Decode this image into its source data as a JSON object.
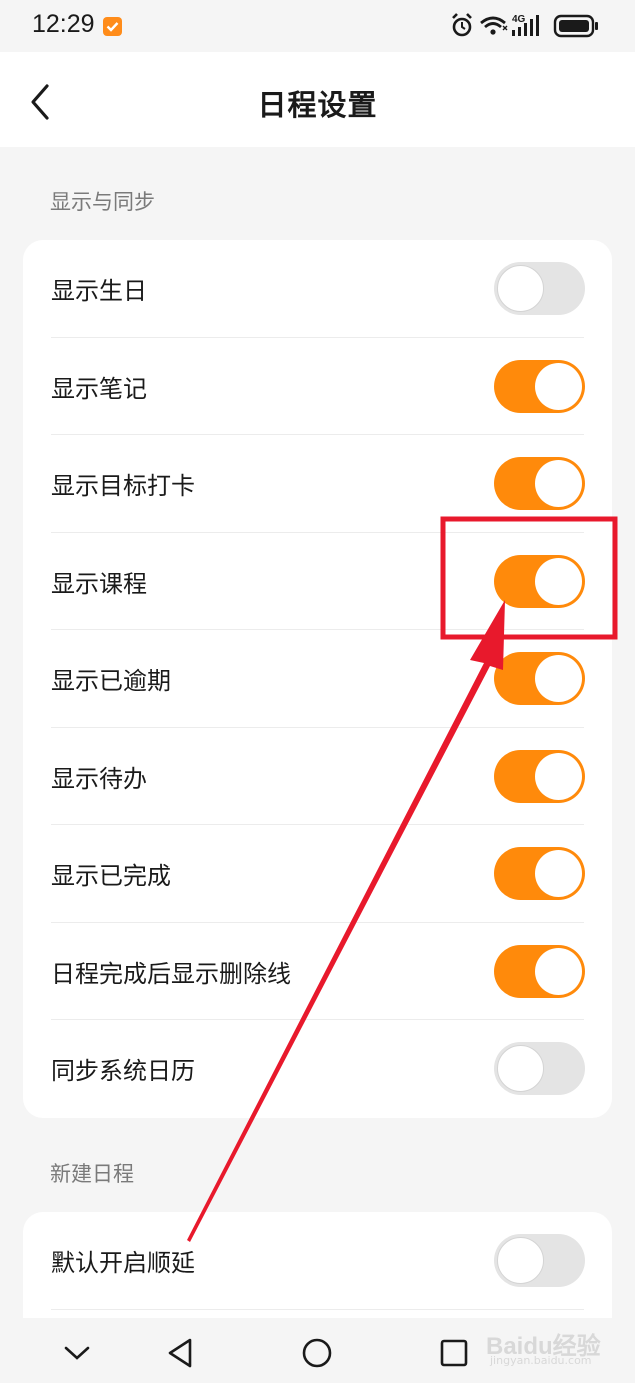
{
  "status_bar": {
    "time": "12:29",
    "network": "4G"
  },
  "header": {
    "back_icon": "chevron-left-icon",
    "title": "日程设置"
  },
  "sections": [
    {
      "label": "显示与同步",
      "items": [
        {
          "label": "显示生日",
          "on": false
        },
        {
          "label": "显示笔记",
          "on": true
        },
        {
          "label": "显示目标打卡",
          "on": true
        },
        {
          "label": "显示课程",
          "on": true
        },
        {
          "label": "显示已逾期",
          "on": true
        },
        {
          "label": "显示待办",
          "on": true
        },
        {
          "label": "显示已完成",
          "on": true
        },
        {
          "label": "日程完成后显示删除线",
          "on": true
        },
        {
          "label": "同步系统日历",
          "on": false
        }
      ]
    },
    {
      "label": "新建日程",
      "items": [
        {
          "label": "默认开启顺延",
          "on": false
        }
      ]
    }
  ],
  "nav_bar": {
    "icons": [
      "chevron-down-icon",
      "back-triangle-icon",
      "home-circle-icon",
      "recents-square-icon"
    ]
  },
  "watermark": {
    "main": "Baidu经验",
    "sub": "jingyan.baidu.com"
  },
  "colors": {
    "accent": "#ff8a0b",
    "toggle_off": "#e4e4e4",
    "annotation_red": "#e8192c",
    "background": "#f5f5f5"
  }
}
